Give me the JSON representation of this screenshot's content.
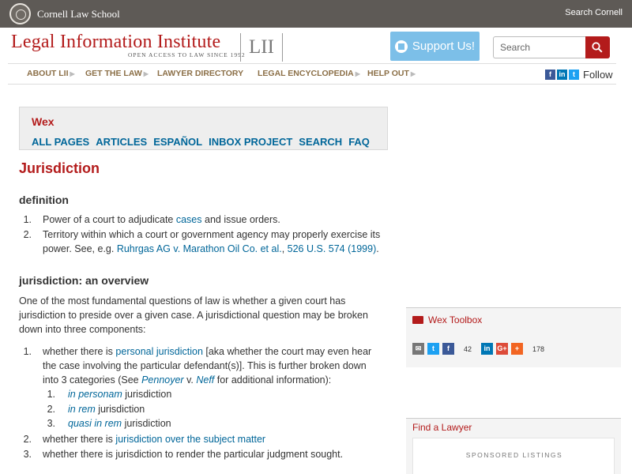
{
  "topbar": {
    "school": "Cornell Law School",
    "search_link": "Search Cornell"
  },
  "header": {
    "title": "Legal Information Institute",
    "tagline": "OPEN ACCESS TO LAW SINCE 1992",
    "logo_box": "LII",
    "support_label": "Support Us!",
    "search_placeholder": "Search"
  },
  "nav": {
    "items": [
      "ABOUT LII",
      "GET THE LAW",
      "LAWYER DIRECTORY",
      "LEGAL ENCYCLOPEDIA",
      "HELP OUT"
    ],
    "follow": "Follow"
  },
  "wex": {
    "title": "Wex",
    "links": [
      "ALL PAGES",
      "ARTICLES",
      "ESPAÑOL",
      "INBOX PROJECT",
      "SEARCH",
      "FAQ"
    ]
  },
  "article": {
    "title": "Jurisdiction",
    "definition_heading": "definition",
    "def1_pre": "Power of a court to adjudicate ",
    "def1_link": "cases",
    "def1_post": " and issue orders.",
    "def2_line1": "Territory within which a court or government agency may properly exercise its",
    "def2_pre": "power. See, e.g. ",
    "def2_link1": "Ruhrgas AG v. Marathon Oil Co. et al.",
    "def2_sep": ", ",
    "def2_link2": "526 U.S. 574 (1999)",
    "def2_post": ".",
    "overview_heading": "jurisdiction: an overview",
    "overview_line1": "One of the most fundamental questions of law is whether a given court has",
    "overview_line2": "jurisdiction to preside over a given case. A jurisdictional question may be broken",
    "overview_line3": "down into three components:",
    "c1_pre": "whether there is ",
    "c1_link": "personal jurisdiction",
    "c1_post": " [aka whether the court may even hear",
    "c1_line2": "the case involving the particular defendant(s)]. This is further broken down",
    "c1_line3_pre": "into 3 categories (See ",
    "c1_link_a": "Pennoyer",
    "c1_v": " v. ",
    "c1_link_b": "Neff",
    "c1_line3_post": " for additional information):",
    "sub1_link": "in personam",
    "sub2_link": "in rem",
    "sub3_link": "quasi in rem",
    "sub_suffix": " jurisdiction",
    "c2_pre": "whether there is ",
    "c2_link": "jurisdiction over the subject matter",
    "c3": "whether there is jurisdiction to render the particular judgment sought."
  },
  "toolbox": {
    "title": "Wex Toolbox",
    "count1": "42",
    "count2": "178"
  },
  "lawyer": {
    "title": "Find a Lawyer",
    "sponsored": "SPONSORED LISTINGS"
  },
  "colors": {
    "brand_red": "#b31b1b",
    "link_blue": "#006699",
    "nav_brown": "#8b6f47",
    "support_blue": "#7cbfe8"
  }
}
